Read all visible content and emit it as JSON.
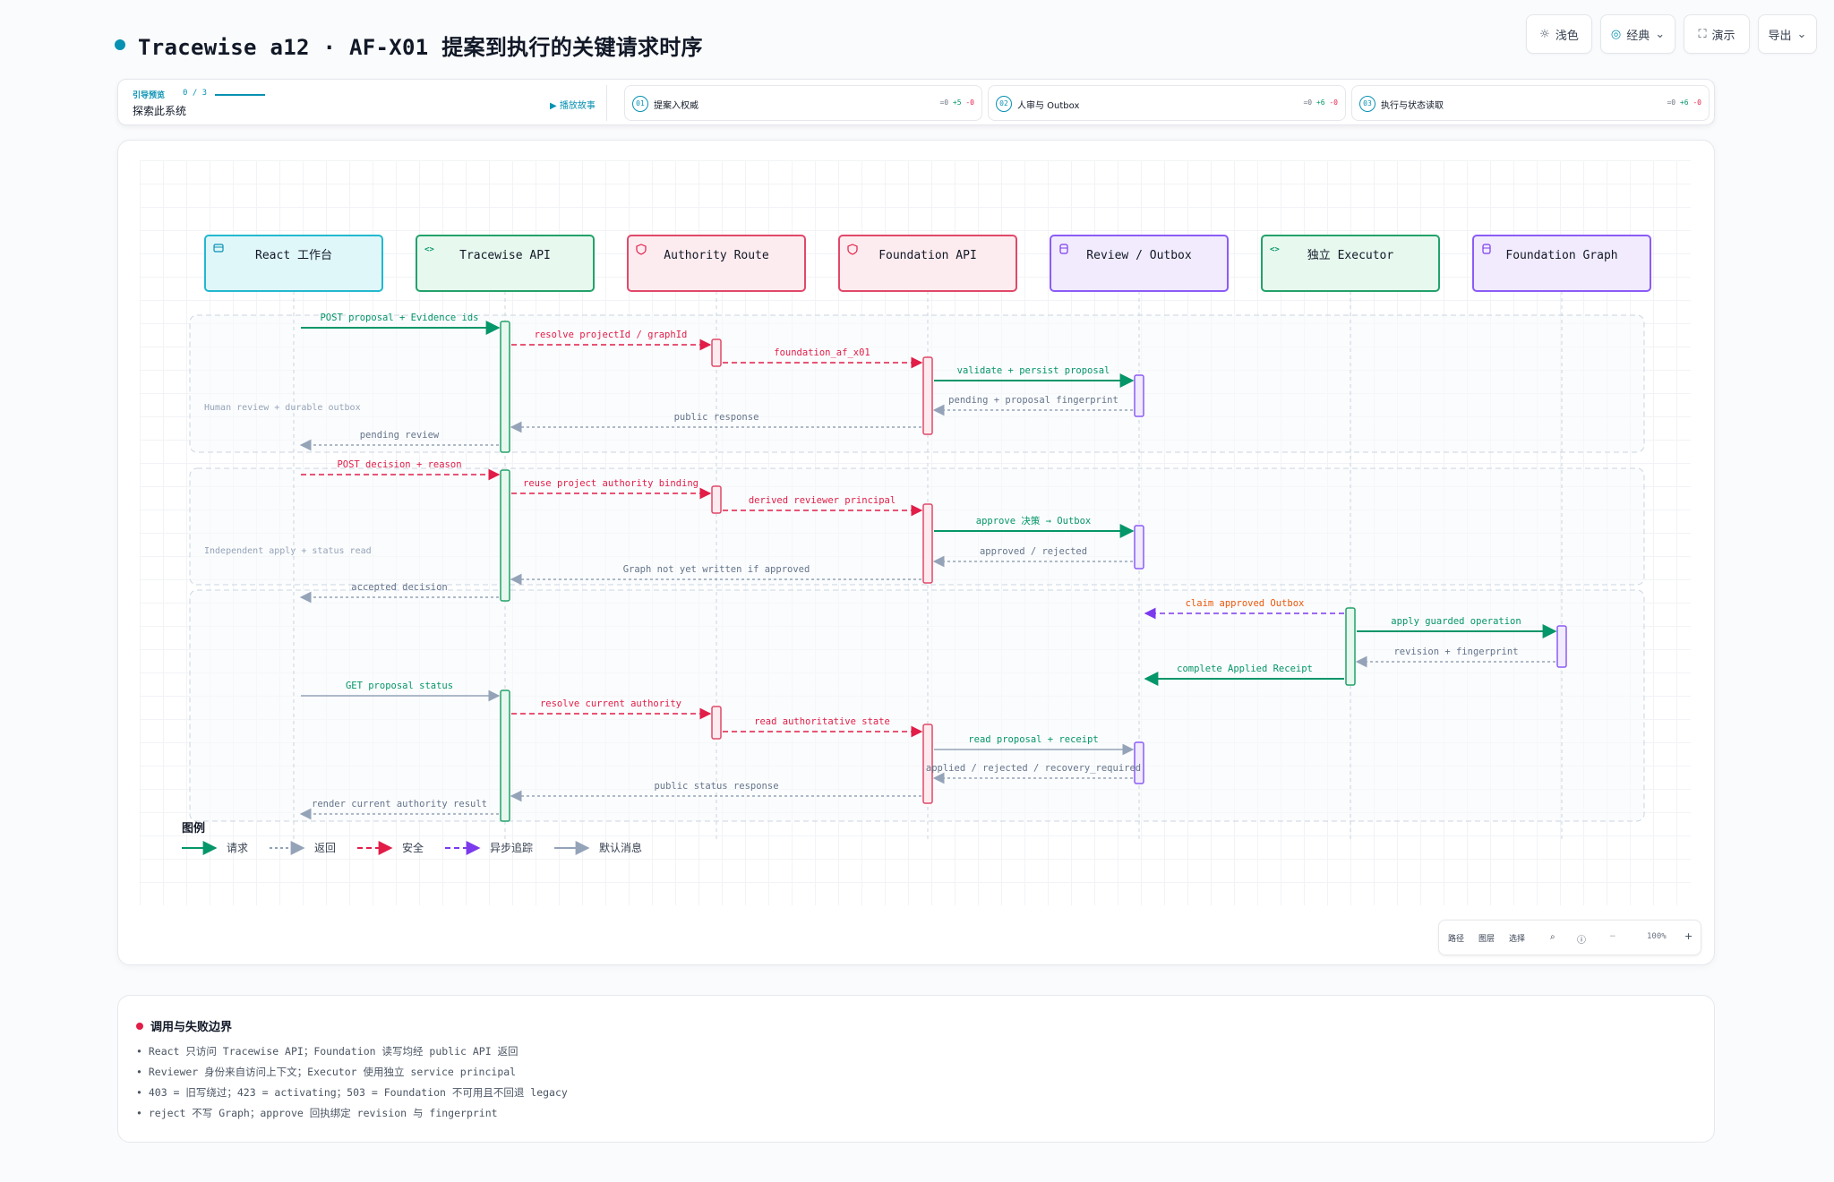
{
  "header": {
    "title": "Tracewise a12 · AF-X01 提案到执行的关键请求时序"
  },
  "toolbar": {
    "light": "浅色",
    "theme": "经典",
    "present": "演示",
    "export": "导出"
  },
  "guide": {
    "label": "引导预览",
    "progress": "0 / 3",
    "explore": "探索此系统",
    "play": "播放故事",
    "steps": [
      {
        "num": "01",
        "title": "提案入权威",
        "adds": "+5",
        "removes": "-0"
      },
      {
        "num": "02",
        "title": "人审与 Outbox",
        "adds": "+6",
        "removes": "-0"
      },
      {
        "num": "03",
        "title": "执行与状态读取",
        "adds": "+6",
        "removes": "-0"
      }
    ]
  },
  "colors": {
    "request": "#059669",
    "return": "#94a3b8",
    "security": "#e11d48",
    "async": "#7c3aed",
    "default": "#94a3b8",
    "claim": "#f97316"
  },
  "diagram": {
    "participants": [
      {
        "name": "React 工作台",
        "kind": "ui",
        "icon": "window-icon"
      },
      {
        "name": "Tracewise API",
        "kind": "api",
        "icon": "code-icon"
      },
      {
        "name": "Authority Route",
        "kind": "sec",
        "icon": "shield-icon"
      },
      {
        "name": "Foundation API",
        "kind": "sec",
        "icon": "shield-icon"
      },
      {
        "name": "Review / Outbox",
        "kind": "store",
        "icon": "database-icon"
      },
      {
        "name": "独立 Executor",
        "kind": "api",
        "icon": "code-icon"
      },
      {
        "name": "Foundation Graph",
        "kind": "store",
        "icon": "database-icon"
      }
    ],
    "groups": [
      {
        "label": "Human review + durable outbox"
      },
      {
        "label": "Independent apply + status read"
      },
      {
        "label": ""
      }
    ],
    "messages": [
      {
        "from": 0,
        "to": 1,
        "label": "POST proposal + Evidence ids",
        "kind": "request"
      },
      {
        "from": 1,
        "to": 2,
        "label": "resolve projectId / graphId",
        "kind": "security"
      },
      {
        "from": 2,
        "to": 3,
        "label": "foundation_af_x01",
        "kind": "security"
      },
      {
        "from": 3,
        "to": 4,
        "label": "validate + persist proposal",
        "kind": "request"
      },
      {
        "from": 4,
        "to": 3,
        "label": "pending + proposal fingerprint",
        "kind": "return"
      },
      {
        "from": 3,
        "to": 1,
        "label": "public response",
        "kind": "return"
      },
      {
        "from": 1,
        "to": 0,
        "label": "pending review",
        "kind": "return"
      },
      {
        "from": 0,
        "to": 1,
        "label": "POST decision + reason",
        "kind": "security"
      },
      {
        "from": 1,
        "to": 2,
        "label": "reuse project authority binding",
        "kind": "security"
      },
      {
        "from": 2,
        "to": 3,
        "label": "derived reviewer principal",
        "kind": "security"
      },
      {
        "from": 3,
        "to": 4,
        "label": "approve 决策 → Outbox",
        "kind": "request"
      },
      {
        "from": 4,
        "to": 3,
        "label": "approved / rejected",
        "kind": "return"
      },
      {
        "from": 3,
        "to": 1,
        "label": "Graph not yet written if approved",
        "kind": "return"
      },
      {
        "from": 1,
        "to": 0,
        "label": "accepted decision",
        "kind": "return"
      },
      {
        "from": 5,
        "to": 4,
        "label": "claim approved Outbox",
        "kind": "async"
      },
      {
        "from": 5,
        "to": 6,
        "label": "apply guarded operation",
        "kind": "request"
      },
      {
        "from": 6,
        "to": 5,
        "label": "revision + fingerprint",
        "kind": "return"
      },
      {
        "from": 5,
        "to": 4,
        "label": "complete Applied Receipt",
        "kind": "request"
      },
      {
        "from": 0,
        "to": 1,
        "label": "GET proposal status",
        "kind": "default"
      },
      {
        "from": 1,
        "to": 2,
        "label": "resolve current authority",
        "kind": "security"
      },
      {
        "from": 2,
        "to": 3,
        "label": "read authoritative state",
        "kind": "security"
      },
      {
        "from": 3,
        "to": 4,
        "label": "read proposal + receipt",
        "kind": "default"
      },
      {
        "from": 4,
        "to": 3,
        "label": "applied / rejected / recovery_required",
        "kind": "return"
      },
      {
        "from": 3,
        "to": 1,
        "label": "public status response",
        "kind": "return"
      },
      {
        "from": 1,
        "to": 0,
        "label": "render current authority result",
        "kind": "return"
      }
    ],
    "legend": {
      "title": "图例",
      "items": [
        {
          "label": "请求",
          "kind": "request"
        },
        {
          "label": "返回",
          "kind": "return"
        },
        {
          "label": "安全",
          "kind": "security"
        },
        {
          "label": "异步追踪",
          "kind": "async"
        },
        {
          "label": "默认消息",
          "kind": "default"
        }
      ]
    }
  },
  "zoom": {
    "path": "路径",
    "layer": "图层",
    "select": "选择",
    "level": "100%"
  },
  "notes": {
    "title": "调用与失败边界",
    "lines": [
      "• React 只访问 Tracewise API；Foundation 读写均经 public API 返回",
      "• Reviewer 身份来自访问上下文；Executor 使用独立 service principal",
      "• 403 = 旧写绕过；423 = activating；503 = Foundation 不可用且不回退 legacy",
      "• reject 不写 Graph；approve 回执绑定 revision 与 fingerprint"
    ]
  }
}
